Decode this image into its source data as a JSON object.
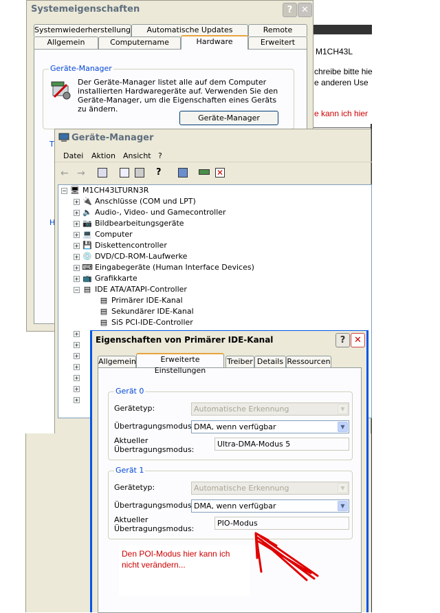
{
  "sys": {
    "title": "Systemeigenschaften",
    "tabs_row1": [
      "Systemwiederherstellung",
      "Automatische Updates",
      "Remote"
    ],
    "tabs_row2": [
      "Allgemein",
      "Computername",
      "Hardware",
      "Erweitert"
    ],
    "group_label": "Geräte-Manager",
    "description": "Der Geräte-Manager listet alle auf dem Computer installierten Hardwaregeräte auf. Verwenden Sie den Geräte-Manager, um die Eigenschaften eines Geräts zu ändern.",
    "button": "Geräte-Manager",
    "group2_initial": "T",
    "group3_initial": "H"
  },
  "bg": {
    "l1": "M1CH43L",
    "l2": "chreibe bitte hie",
    "l3": "e anderen Use",
    "l4": "e kann ich hier"
  },
  "dm": {
    "title": "Geräte-Manager",
    "menu": [
      "Datei",
      "Aktion",
      "Ansicht",
      "?"
    ],
    "root": "M1CH43LTURN3R",
    "items": [
      "Anschlüsse (COM und LPT)",
      "Audio-, Video- und Gamecontroller",
      "Bildbearbeitungsgeräte",
      "Computer",
      "Diskettencontroller",
      "DVD/CD-ROM-Laufwerke",
      "Eingabegeräte (Human Interface Devices)",
      "Grafikkarte",
      "IDE ATA/ATAPI-Controller"
    ],
    "ide_children": [
      "Primärer IDE-Kanal",
      "Sekundärer IDE-Kanal",
      "SiS PCI-IDE-Controller"
    ]
  },
  "props": {
    "title": "Eigenschaften von Primärer IDE-Kanal",
    "tabs": [
      "Allgemein",
      "Erweiterte Einstellungen",
      "Treiber",
      "Details",
      "Ressourcen"
    ],
    "dev0": {
      "label": "Gerät 0",
      "type_label": "Gerätetyp:",
      "type_value": "Automatische Erkennung",
      "mode_label": "Übertragungsmodus:",
      "mode_value": "DMA, wenn verfügbar",
      "cur_label1": "Aktueller",
      "cur_label2": "Übertragungsmodus:",
      "cur_value": "Ultra-DMA-Modus 5"
    },
    "dev1": {
      "label": "Gerät 1",
      "type_label": "Gerätetyp:",
      "type_value": "Automatische Erkennung",
      "mode_label": "Übertragungsmodus:",
      "mode_value": "DMA, wenn verfügbar",
      "cur_label1": "Aktueller",
      "cur_label2": "Übertragungsmodus:",
      "cur_value": "PIO-Modus"
    }
  },
  "annotation": {
    "line1": "Den POI-Modus hier kann ich",
    "line2": "nicht verändern...",
    "color": "#cc0000"
  },
  "help_glyph": "?",
  "close_glyph": "✕"
}
